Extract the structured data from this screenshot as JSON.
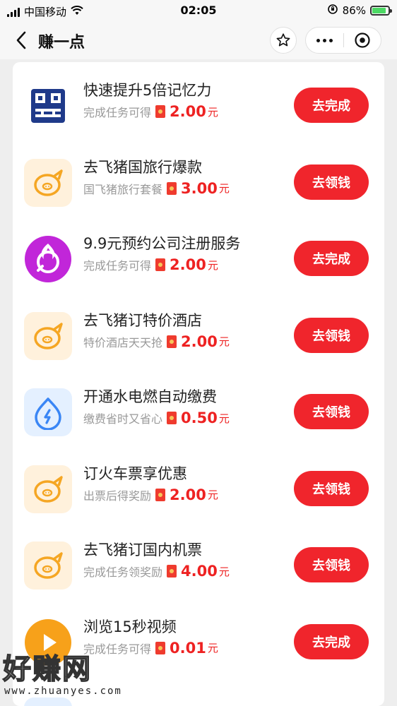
{
  "status_bar": {
    "carrier": "中国移动",
    "time": "02:05",
    "battery_percent": "86%",
    "battery_level": 0.86
  },
  "nav": {
    "title": "赚一点"
  },
  "tasks": [
    {
      "name": "快速提升5倍记忆力",
      "desc": "完成任务可得",
      "amount": "2.00",
      "unit": "元",
      "button": "去完成",
      "icon": "memory-app-icon"
    },
    {
      "name": "去飞猪国旅行爆款",
      "desc": "国飞猪旅行套餐",
      "amount": "3.00",
      "unit": "元",
      "button": "去领钱",
      "icon": "fliggy-icon"
    },
    {
      "name": "9.9元预约公司注册服务",
      "desc": "完成任务可得",
      "amount": "2.00",
      "unit": "元",
      "button": "去完成",
      "icon": "flame-service-icon"
    },
    {
      "name": "去飞猪订特价酒店",
      "desc": "特价酒店天天抢",
      "amount": "2.00",
      "unit": "元",
      "button": "去领钱",
      "icon": "fliggy-icon"
    },
    {
      "name": "开通水电燃自动缴费",
      "desc": "缴费省时又省心",
      "amount": "0.50",
      "unit": "元",
      "button": "去领钱",
      "icon": "utility-payment-icon"
    },
    {
      "name": "订火车票享优惠",
      "desc": "出票后得奖励",
      "amount": "2.00",
      "unit": "元",
      "button": "去领钱",
      "icon": "fliggy-icon"
    },
    {
      "name": "去飞猪订国内机票",
      "desc": "完成任务领奖励",
      "amount": "4.00",
      "unit": "元",
      "button": "去领钱",
      "icon": "fliggy-icon"
    },
    {
      "name": "浏览15秒视频",
      "desc": "完成任务可得",
      "amount": "0.01",
      "unit": "元",
      "button": "去完成",
      "icon": "video-play-icon"
    }
  ],
  "watermark": {
    "title": "好赚网",
    "url": "www.zhuanyes.com"
  },
  "colors": {
    "accent_red": "#f0252c",
    "amount_red": "#e22222",
    "fliggy_bg": "#fff1dc",
    "fliggy_orange": "#f5a623"
  }
}
